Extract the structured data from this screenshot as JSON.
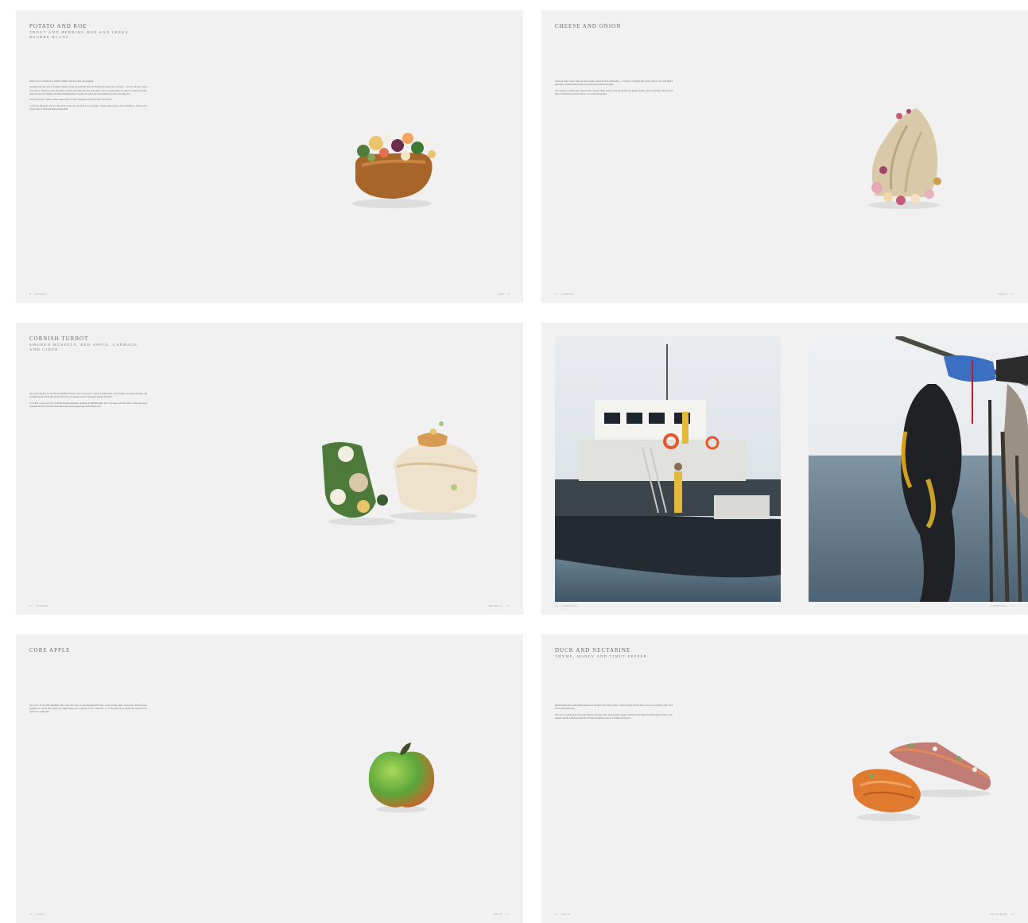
{
  "spreads": [
    {
      "title": "POTATO AND ROE",
      "subtitle": "TROUT AND HERRING ROE AND LEEKS BEURRE BLANC",
      "paragraphs": [
        "This is one of Cornish Amy's childhood dishes, with one of my own elements.",
        "Growing up by the coast of Northern Ireland, I loved one particular dish: the Wednesday jacket potato of home — cut and with sour cream, and with roe: picked up at the fish market as often, but would later also serve leeks. I later loved the potato for what it is, baked in its skin, gently broken, then finished with butter. Blending these two memories with a few other elements gave me a starting point.",
        "We plated it with a cured roe, then a beurre blanc of leeks, alongside a few micro herbs and flowers.",
        "I would say this potato and roe will always be my own. We have it on one menu or another most seasons, and it continues to evolve, but it always tastes of home and makes people smile."
      ],
      "folio_left": "8 · POTATO",
      "folio_right": "ROE · 9"
    },
    {
      "title": "CHEESE AND ONION",
      "subtitle": "",
      "paragraphs": [
        "Cheese & onion crisps, cheese & onion pasties, cheese & onion sandwiches — I wanted to reimagine this pairing with the very best British ingredients, and the onion became both vessel and garnish on the plate.",
        "Our version is a baked onion, layered with a savoury cheese custard, crisp onion petals and pickled shallots, with a scattering of flowers and herbs. It's the flavour everyone knows, in a form that surprises."
      ],
      "folio_left": "10 · CHEESE",
      "folio_right": "ONION · 11"
    },
    {
      "title": "CORNISH TURBOT",
      "subtitle": "SMOKED MUSSELS, RED APPLE, CABBAGE AND CIDER",
      "paragraphs": [
        "We get the majority of our fish and shellfish from the coast of Cornwall, a region of Britain with a rich culinary and cultural heritage, and incredible produce from land and sea. From the cold Atlantic waters come turbot, mussels and more.",
        "To do this, we use one of our favourite kitchen techniques: dressing our shellfish gently in its own liquor, with the cider, cabbage and apple alongside the fish, so that the whole plate tastes of the rugged edge of the British coast."
      ],
      "folio_left": "12 · TURBOT",
      "folio_right": "MUSSELS · 13"
    },
    {
      "title": "",
      "subtitle": "",
      "paragraphs": [],
      "folio_left": "14 · CORNWALL",
      "folio_right": "CORNWALL · 15"
    },
    {
      "title": "CORE APPLE",
      "subtitle": "",
      "paragraphs": [
        "We look to do the little 'Ripening' with a taste like Core, an ever-changing dish based on the seasons: apple, sorrel and a delicate glaze, presented as a whole fruit. Inside lies a light mousse and a compote, set on a crisp base — it is the perfect Core dessert: the orchard's best, captured in a single bite."
      ],
      "folio_left": "16 · CORE",
      "folio_right": "APPLE · 17"
    },
    {
      "title": "DUCK AND NECTARINE",
      "subtitle": "THYME, HONEY AND TIMUT PEPPER",
      "paragraphs": [
        "British poultry has a well-earned reputation as the best in the world, owing to careful rearing, and the duck we use is no exception, with a rich flavour and tender meat.",
        "This way of cooking duck was slowly refined over many years: the nectarine is glazed with honey and thyme, the timut pepper brings a citrus warmth, and the combination lifts the rich meat through the seasons of summer and beyond."
      ],
      "folio_left": "18 · DUCK",
      "folio_right": "NECTARINE · 19"
    }
  ]
}
